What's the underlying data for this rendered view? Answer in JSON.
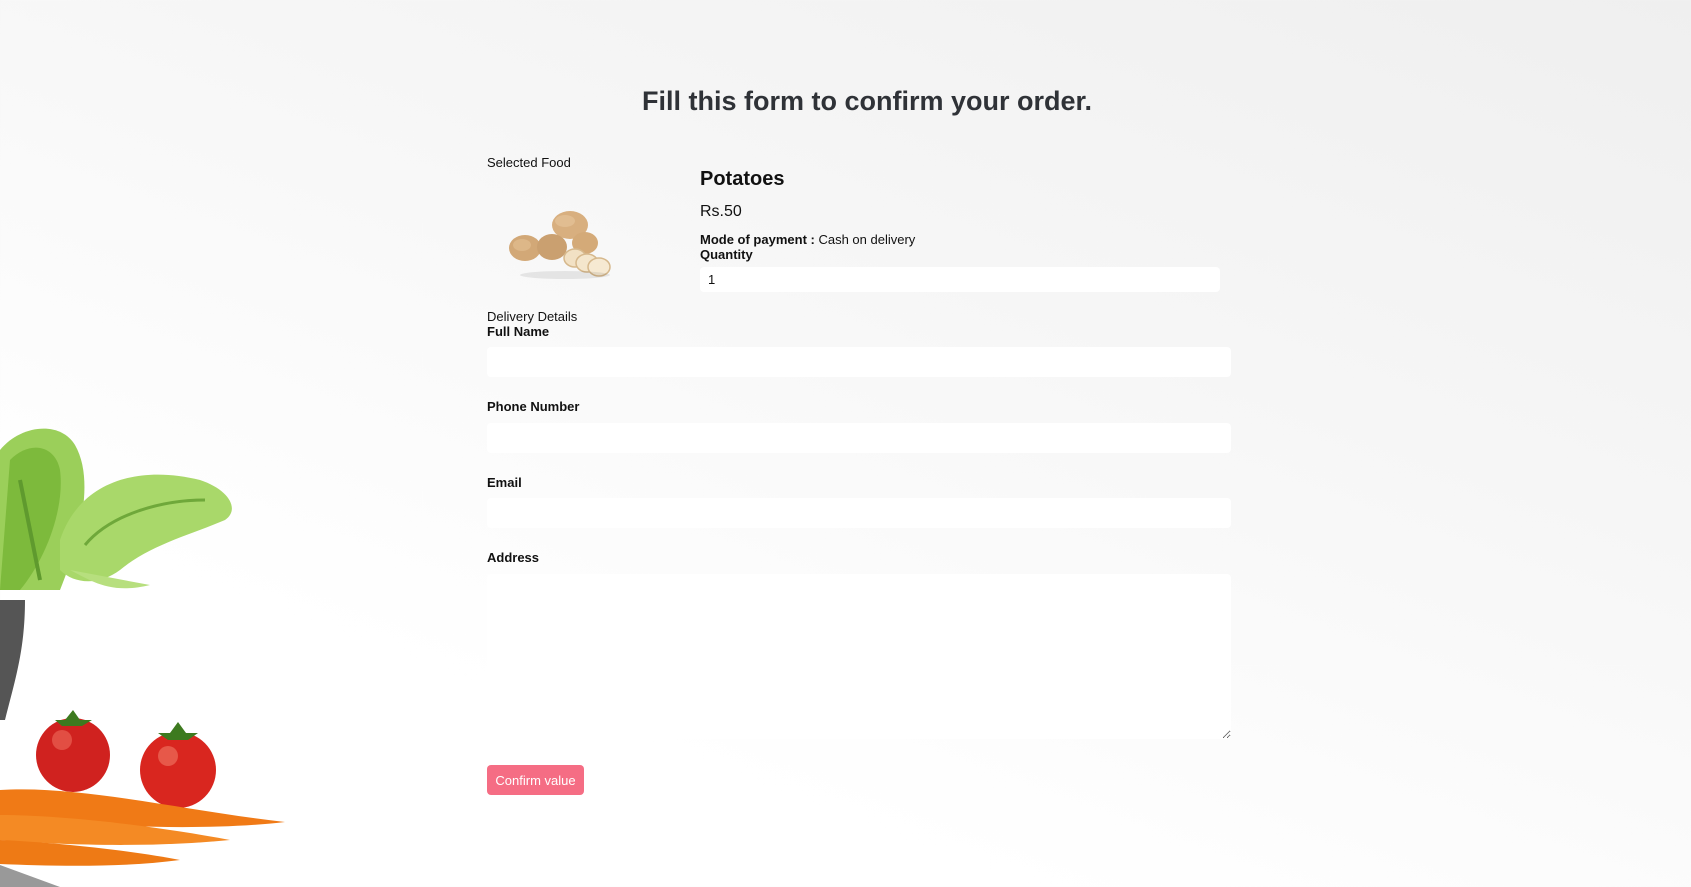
{
  "page": {
    "title": "Fill this form to confirm your order."
  },
  "food": {
    "section_label": "Selected Food",
    "image_icon": "potatoes-image",
    "name": "Potatoes",
    "price": "Rs.50",
    "payment_label": "Mode of payment :",
    "payment_value": "Cash on delivery",
    "quantity_label": "Quantity",
    "quantity_value": "1"
  },
  "delivery": {
    "section_label": "Delivery Details",
    "full_name_label": "Full Name",
    "full_name_value": "",
    "phone_label": "Phone Number",
    "phone_value": "",
    "email_label": "Email",
    "email_value": "",
    "address_label": "Address",
    "address_value": ""
  },
  "actions": {
    "confirm_label": "Confirm value"
  },
  "colors": {
    "accent": "#f56d84",
    "title": "#2f3237"
  },
  "decor": {
    "background_icon": "vegetables-illustration"
  }
}
